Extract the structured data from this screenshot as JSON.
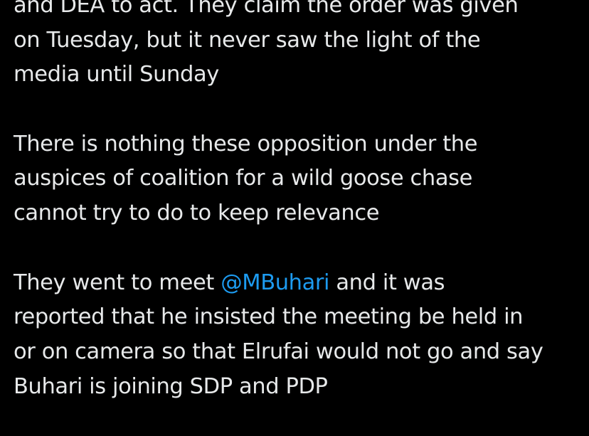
{
  "colors": {
    "background": "#000000",
    "text": "#e7e9ea",
    "mention": "#1d9bf0"
  },
  "tweet": {
    "paragraph1": {
      "line1": "and DEA to act. They claim the order was given",
      "line2": "on Tuesday, but it never saw the light of the",
      "line3": "media until Sunday"
    },
    "paragraph2": {
      "line1": "There is nothing these opposition under the",
      "line2": "auspices of coalition for a wild goose chase",
      "line3": "cannot try to do to keep relevance"
    },
    "paragraph3": {
      "line1_before": "They went to meet ",
      "mention": "@MBuhari",
      "line1_after": " and it was",
      "line2": "reported that he insisted the meeting be held in",
      "line3": "or on camera so that Elrufai would not go and say",
      "line4": "Buhari is joining SDP and PDP"
    }
  }
}
